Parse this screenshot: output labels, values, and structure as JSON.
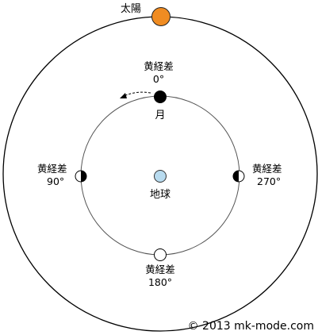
{
  "colors": {
    "sun": "#f08c22",
    "earth": "#b8dbef",
    "line": "#000000",
    "orbit_inner": "#555555",
    "background": "#ffffff"
  },
  "sun": {
    "label": "太陽"
  },
  "earth": {
    "label": "地球"
  },
  "moon": {
    "label": "月"
  },
  "positions": [
    {
      "label": "黄経差",
      "degree": "0°",
      "phase": "new"
    },
    {
      "label": "黄経差",
      "degree": "90°",
      "phase": "first-quarter"
    },
    {
      "label": "黄経差",
      "degree": "180°",
      "phase": "full"
    },
    {
      "label": "黄経差",
      "degree": "270°",
      "phase": "last-quarter"
    }
  ],
  "copyright": "© 2013 mk-mode.com"
}
